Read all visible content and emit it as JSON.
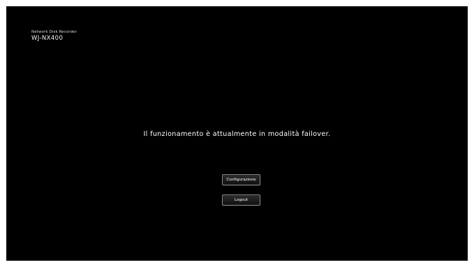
{
  "header": {
    "product_line": "Network Disk Recorder",
    "model": "WJ-NX400"
  },
  "main": {
    "status_message": "Il funzionamento è attualmente in modalità failover."
  },
  "buttons": {
    "configuration_label": "Configurazione",
    "logout_label": "Logout"
  },
  "colors": {
    "background": "#000000",
    "text": "#ffffff",
    "button_border": "#8f8f8f"
  }
}
